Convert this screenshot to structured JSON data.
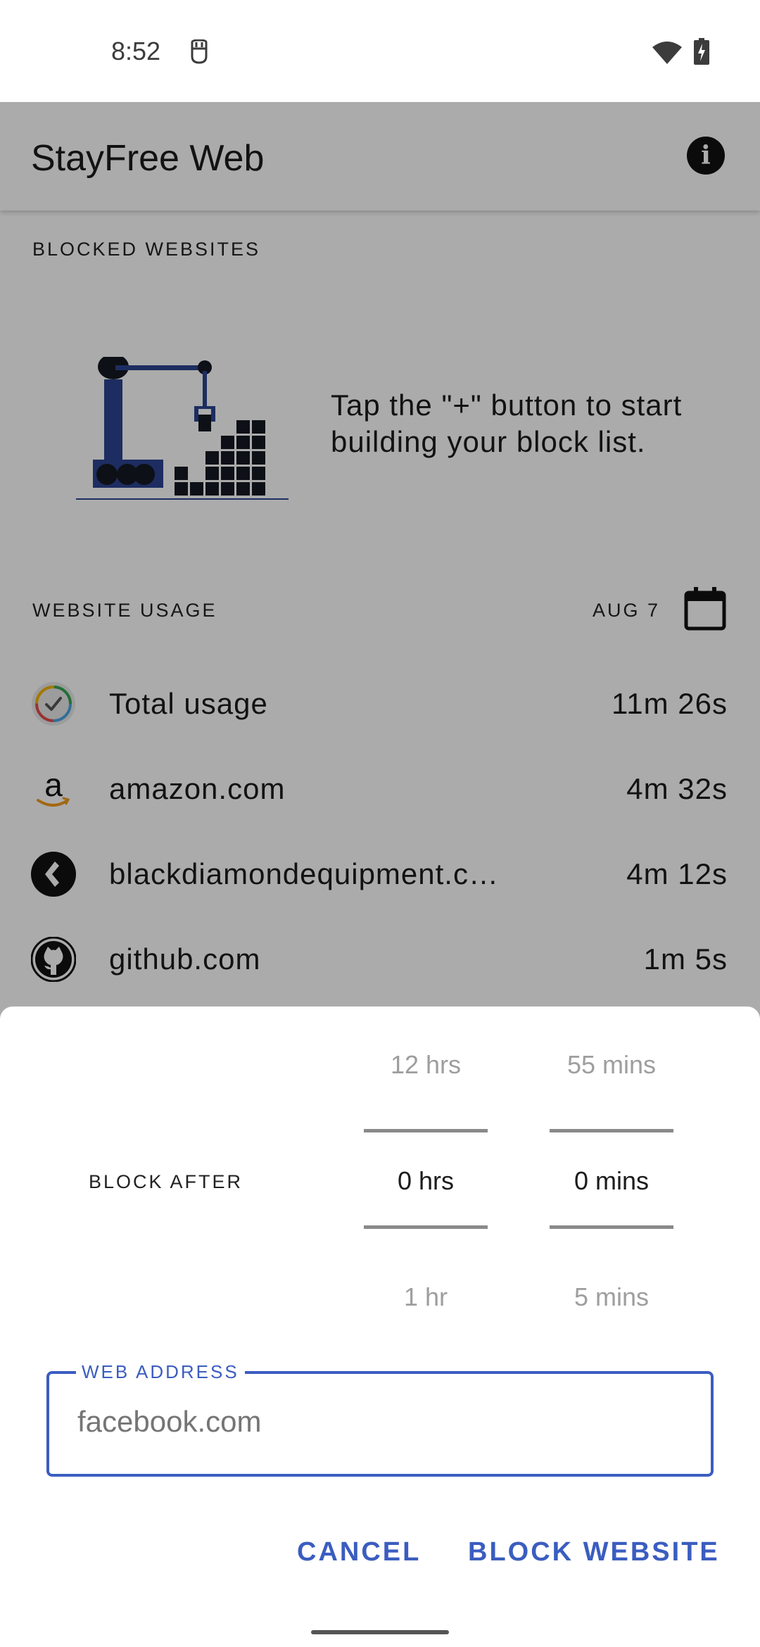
{
  "status_bar": {
    "time": "8:52",
    "icons": [
      "notification-app-icon",
      "wifi-icon",
      "battery-charging-icon"
    ]
  },
  "app_bar": {
    "title": "StayFree Web",
    "info_icon": "info-icon",
    "info_glyph": "i"
  },
  "blocked_section": {
    "header": "BLOCKED WEBSITES",
    "empty_message": "Tap the \"+\" button to start building your block list.",
    "illustration": "crane-building-blocks-illustration"
  },
  "usage_section": {
    "header": "WEBSITE USAGE",
    "date": "AUG 7",
    "calendar_icon": "calendar-icon",
    "rows": [
      {
        "icon": "clock-usage-icon",
        "name": "Total usage",
        "time": "11m 26s"
      },
      {
        "icon": "amazon-icon",
        "name": "amazon.com",
        "time": "4m 32s"
      },
      {
        "icon": "black-diamond-icon",
        "name": "blackdiamondequipment.c…",
        "time": "4m 12s"
      },
      {
        "icon": "github-icon",
        "name": "github.com",
        "time": "1m 5s"
      }
    ]
  },
  "sheet": {
    "block_after_label": "BLOCK AFTER",
    "hours_picker": {
      "prev": "12 hrs",
      "selected": "0 hrs",
      "next": "1 hr"
    },
    "minutes_picker": {
      "prev": "55 mins",
      "selected": "0 mins",
      "next": "5 mins"
    },
    "web_address": {
      "label": "WEB ADDRESS",
      "placeholder": "facebook.com",
      "value": ""
    },
    "cancel_label": "CANCEL",
    "block_label": "BLOCK WEBSITE"
  },
  "colors": {
    "accent": "#3b5dc0",
    "scrim": "rgba(0,0,0,0.33)",
    "illustration_blue": "#2c4391",
    "illustration_dark": "#141821"
  }
}
